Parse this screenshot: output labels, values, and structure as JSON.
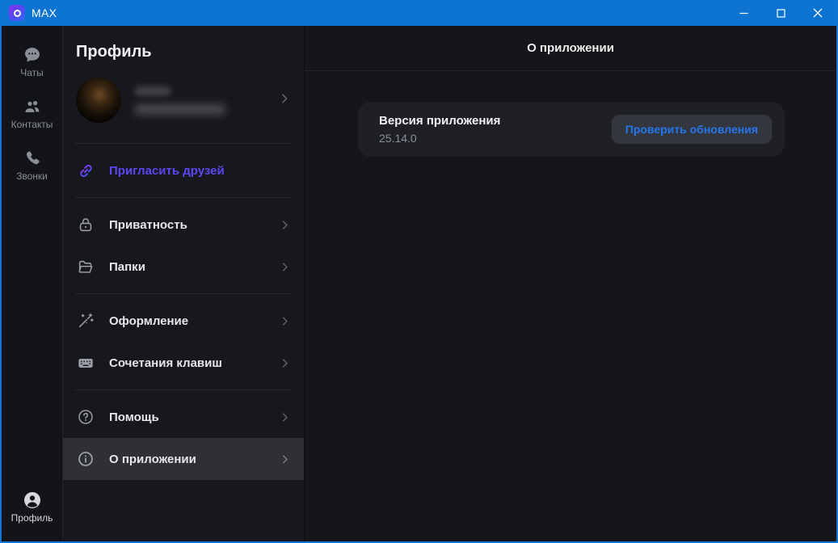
{
  "window": {
    "app_title": "MAX"
  },
  "colors": {
    "titlebar_blue": "#0d74d2",
    "window_border_blue": "#0b76d6",
    "accent_violet": "#5b47f3",
    "button_text_blue": "#2577ee",
    "selected_item_bg": "#2e3036",
    "card_bg": "#1e2025"
  },
  "rail": {
    "items": [
      {
        "label": "Чаты",
        "icon": "chats-icon"
      },
      {
        "label": "Контакты",
        "icon": "contacts-icon"
      },
      {
        "label": "Звонки",
        "icon": "calls-icon"
      }
    ],
    "profile": {
      "label": "Профиль",
      "icon": "profile-icon",
      "active": true
    }
  },
  "profile_panel": {
    "title": "Профиль",
    "menu": [
      {
        "label": "Пригласить друзей",
        "icon": "invite-link-icon",
        "accent": true
      },
      {
        "label": "Приватность",
        "icon": "lock-icon"
      },
      {
        "label": "Папки",
        "icon": "folder-icon"
      },
      {
        "label": "Оформление",
        "icon": "magic-wand-icon"
      },
      {
        "label": "Сочетания клавиш",
        "icon": "keyboard-icon"
      },
      {
        "label": "Помощь",
        "icon": "help-icon"
      },
      {
        "label": "О приложении",
        "icon": "info-icon",
        "selected": true
      }
    ]
  },
  "about_panel": {
    "title": "О приложении",
    "version_label": "Версия приложения",
    "version_value": "25.14.0",
    "check_updates_button": "Проверить обновления"
  }
}
